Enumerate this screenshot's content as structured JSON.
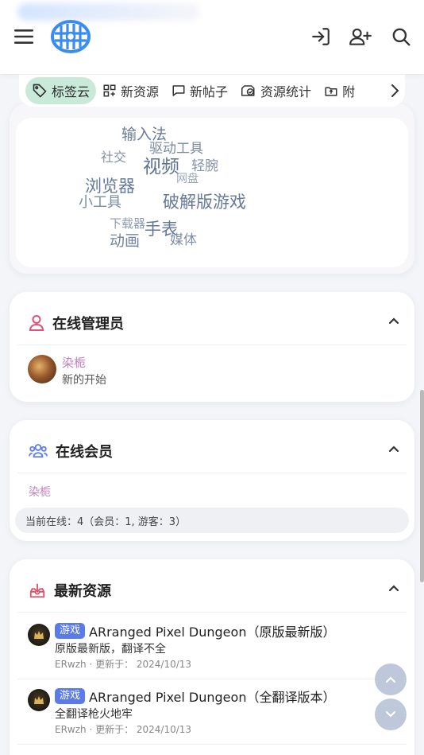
{
  "tabs": [
    {
      "label": "标签云",
      "icon": "tag-icon",
      "active": true
    },
    {
      "label": "新资源",
      "icon": "grid-icon"
    },
    {
      "label": "新帖子",
      "icon": "comment-icon"
    },
    {
      "label": "资源统计",
      "icon": "stats-icon"
    },
    {
      "label": "附",
      "icon": "upload-box-icon"
    }
  ],
  "tag_cloud": [
    {
      "text": "输入法",
      "size": 19,
      "color": "#6a7d98"
    },
    {
      "text": "社交",
      "size": 16,
      "color": "#8292a8"
    },
    {
      "text": "驱动工具",
      "size": 17,
      "color": "#7a8aa2"
    },
    {
      "text": "视频",
      "size": 23,
      "color": "#5e7290"
    },
    {
      "text": "轻腕",
      "size": 17,
      "color": "#8494ab"
    },
    {
      "text": "网盘",
      "size": 14,
      "color": "#9aa8bb"
    },
    {
      "text": "浏览器",
      "size": 21,
      "color": "#64789a"
    },
    {
      "text": "小工具",
      "size": 18,
      "color": "#7c8ca3"
    },
    {
      "text": "破解版游戏",
      "size": 21,
      "color": "#66799a"
    },
    {
      "text": "下载器",
      "size": 15,
      "color": "#8e9cb0"
    },
    {
      "text": "手表",
      "size": 21,
      "color": "#63779a"
    },
    {
      "text": "动画",
      "size": 19,
      "color": "#7385a0"
    },
    {
      "text": "媒体",
      "size": 17,
      "color": "#8090a8"
    }
  ],
  "online_admins": {
    "title": "在线管理员",
    "admin": {
      "name": "染栀",
      "subtitle": "新的开始"
    }
  },
  "online_members": {
    "title": "在线会员",
    "member": "染栀",
    "summary": "当前在线：4（会员：1, 游客：3）"
  },
  "latest_resources": {
    "title": "最新资源",
    "items": [
      {
        "badge": "游戏",
        "title": "ARranged Pixel Dungeon（原版最新版）",
        "desc": "原版最新版，翻译不全",
        "meta": "ERwzh · 更新于： 2024/10/13"
      },
      {
        "badge": "游戏",
        "title": "ARranged Pixel Dungeon（全翻译版本）",
        "desc": "全翻译枪火地牢",
        "meta": "ERwzh · 更新于： 2024/10/13"
      }
    ]
  },
  "colors": {
    "accent": "#5b7be8",
    "active_tab": "#c9ead9",
    "admin_name": "#c780c4",
    "logo": "#3b8cf0"
  }
}
